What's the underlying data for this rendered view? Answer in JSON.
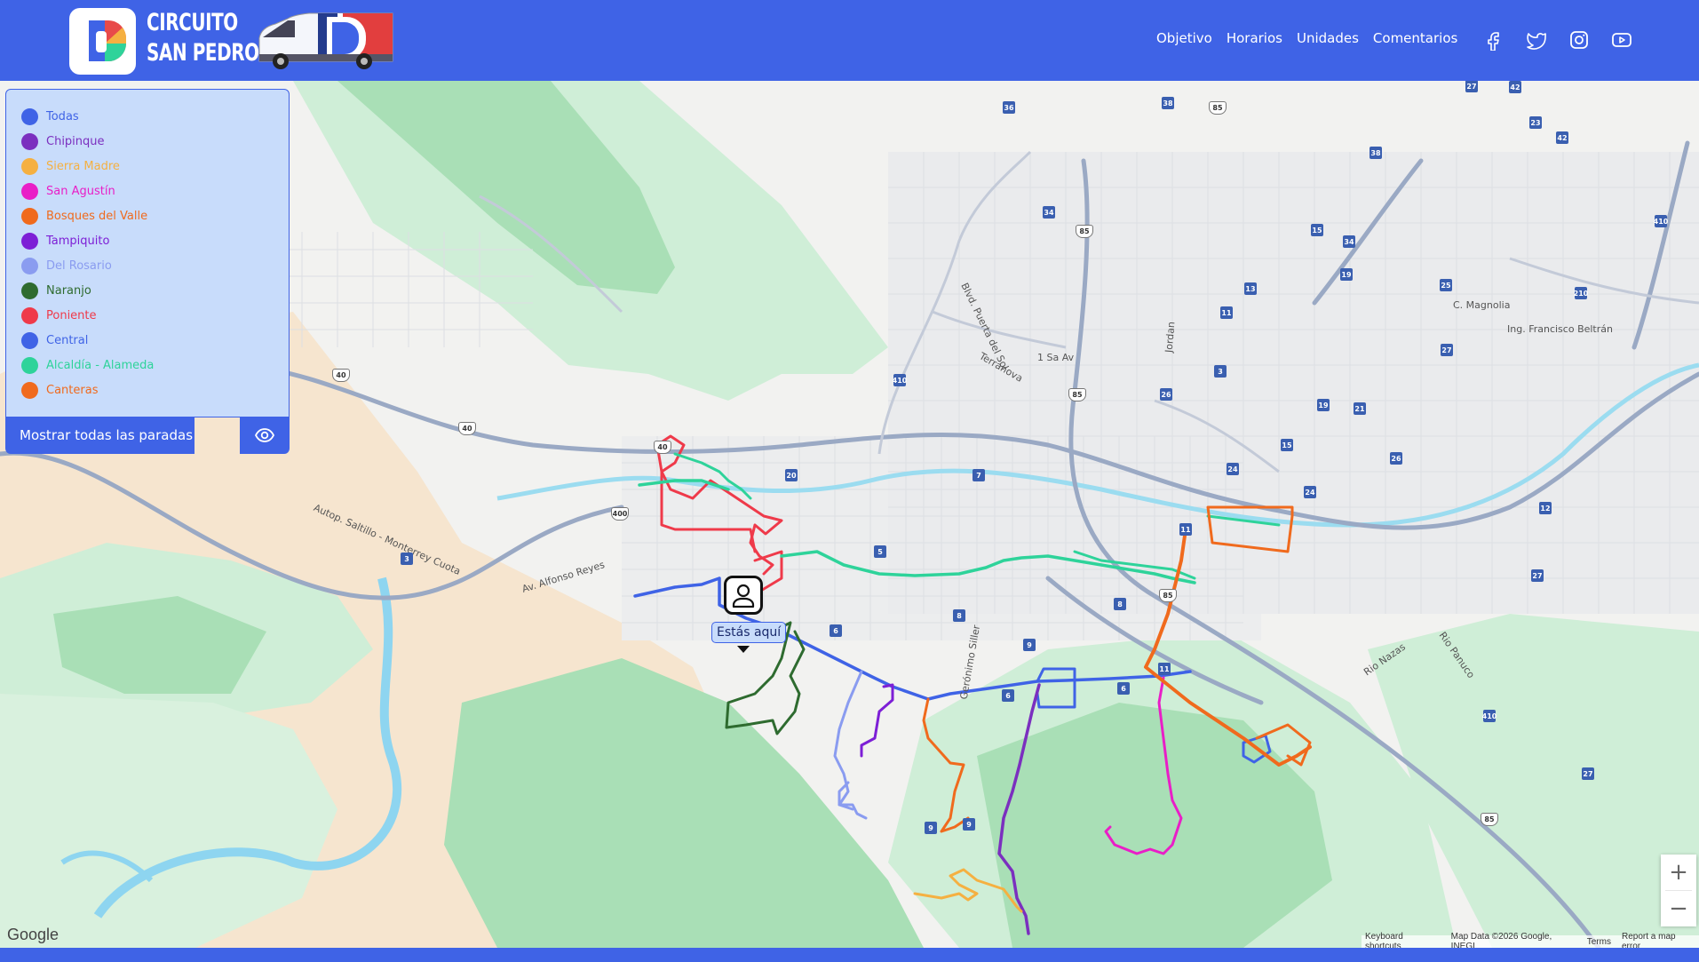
{
  "header": {
    "brand_line1": "CIRCUITO",
    "brand_line2": "SAN PEDRO",
    "nav": [
      "Objetivo",
      "Horarios",
      "Unidades",
      "Comentarios"
    ],
    "social_icons": [
      "facebook-icon",
      "twitter-icon",
      "instagram-icon",
      "youtube-icon"
    ],
    "bg_color": "#3f63e6"
  },
  "legend": {
    "items": [
      {
        "label": "Todas",
        "color": "#3f63e6"
      },
      {
        "label": "Chipinque",
        "color": "#7b2fbf"
      },
      {
        "label": "Sierra Madre",
        "color": "#f5b041"
      },
      {
        "label": "San Agustín",
        "color": "#e91ec7"
      },
      {
        "label": "Bosques del Valle",
        "color": "#f06a1d"
      },
      {
        "label": "Tampiquito",
        "color": "#7d1fd6"
      },
      {
        "label": "Del Rosario",
        "color": "#8a9cf0"
      },
      {
        "label": "Naranjo",
        "color": "#2e6b2f"
      },
      {
        "label": "Poniente",
        "color": "#ef3a4a"
      },
      {
        "label": "Central",
        "color": "#3f63e6"
      },
      {
        "label": "Alcaldía - Alameda",
        "color": "#2ed39a"
      },
      {
        "label": "Canteras",
        "color": "#f06a1d"
      }
    ],
    "show_all_stops": "Mostrar todas las paradas",
    "eye_icon": "eye-icon"
  },
  "map": {
    "here_label": "Estás aquí",
    "zoom_in": "+",
    "zoom_out": "−",
    "google": "Google",
    "attribution": [
      "Keyboard shortcuts",
      "Map Data ©2026 Google, INEGI",
      "Terms",
      "Report a map error"
    ],
    "labels": {
      "terranova": "Terranova",
      "av15": "1 Sa Av",
      "jordan": "Jordan",
      "magnolia": "C. Magnolia",
      "beltran": "Ing. Francisco Beltrán",
      "puerta_sol": "Blvd. Puerta del Sol",
      "autopista": "Autop. Saltillo - Monterrey Cuota",
      "alfonso_reyes": "Av. Alfonso Reyes",
      "rio_nazas": "Rio Nazas",
      "rio_panuco": "Rio Panuco",
      "geronimo": "Gerónimo Siller"
    },
    "shields": [
      "36",
      "38",
      "85",
      "34",
      "85",
      "27",
      "42",
      "23",
      "42",
      "38",
      "15",
      "34",
      "19",
      "410",
      "25",
      "210",
      "13",
      "11",
      "27",
      "40",
      "40",
      "3",
      "26",
      "85",
      "19",
      "21",
      "15",
      "24",
      "24",
      "26",
      "3",
      "40",
      "410",
      "7",
      "20",
      "11",
      "85",
      "12",
      "5",
      "8",
      "8",
      "11",
      "27",
      "6",
      "9",
      "6",
      "6",
      "11",
      "410",
      "27",
      "85",
      "9",
      "9",
      "3",
      "400"
    ]
  }
}
